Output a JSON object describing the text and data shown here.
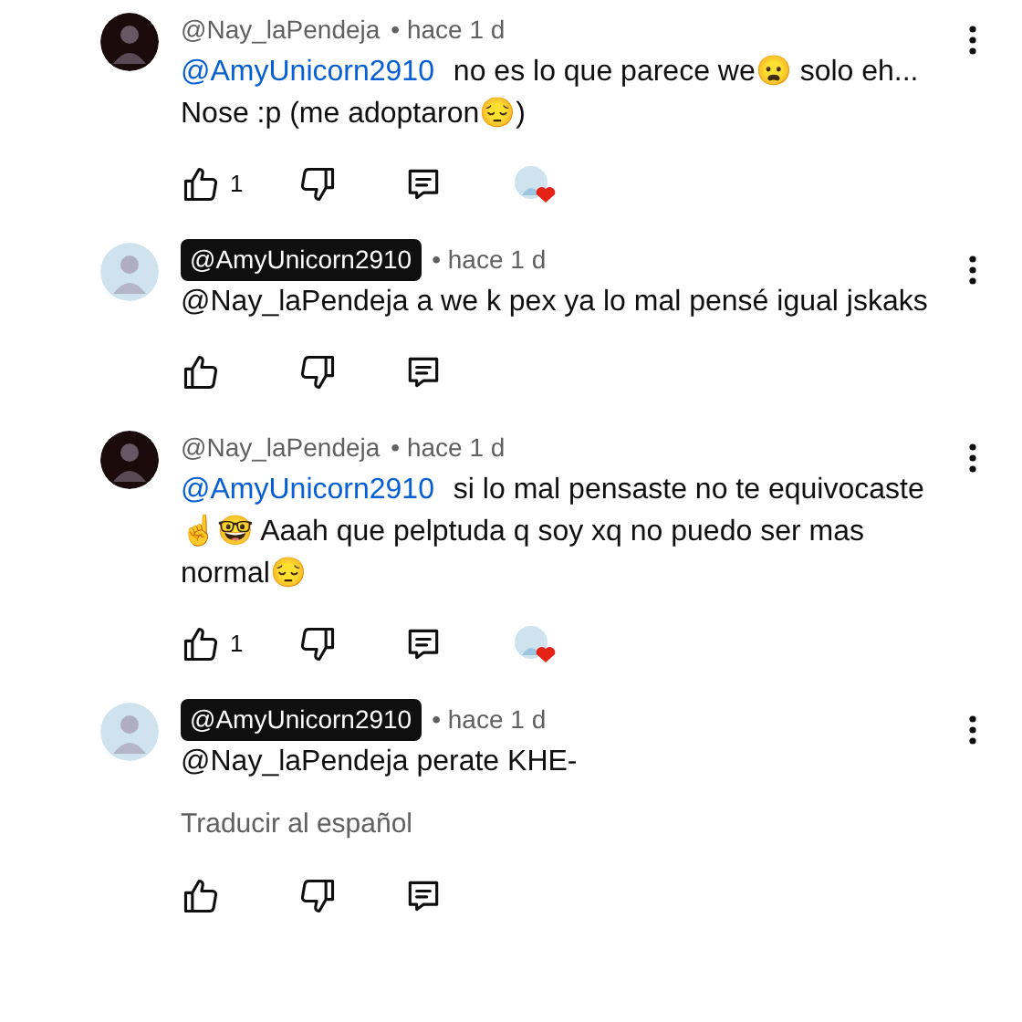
{
  "comments": [
    {
      "author": "@Nay_laPendeja",
      "creator_badge": false,
      "avatar": {
        "color": "#1a0a0a"
      },
      "time": "• hace 1 d",
      "mention": "@AmyUnicorn2910",
      "text": "no es lo que parece we😦 solo eh... Nose :p (me adoptaron😔)",
      "likes": "1",
      "hearted": true
    },
    {
      "author": "@AmyUnicorn2910",
      "creator_badge": true,
      "avatar": {
        "color": "#cfe3ef"
      },
      "time": "• hace 1 d",
      "text": "@Nay_laPendeja a we k pex ya lo mal pensé igual jskaks",
      "hearted": false
    },
    {
      "author": "@Nay_laPendeja",
      "creator_badge": false,
      "avatar": {
        "color": "#1a0a0a"
      },
      "time": "• hace 1 d",
      "mention": "@AmyUnicorn2910",
      "text": "si lo mal pensaste no te equivocaste ☝️🤓 Aaah que pelptuda q soy xq no puedo ser mas normal😔",
      "likes": "1",
      "hearted": true
    },
    {
      "author": "@AmyUnicorn2910",
      "creator_badge": true,
      "avatar": {
        "color": "#cfe3ef"
      },
      "time": "• hace 1 d",
      "text": "@Nay_laPendeja perate KHE-",
      "translate": "Traducir al español",
      "hearted": false
    }
  ]
}
